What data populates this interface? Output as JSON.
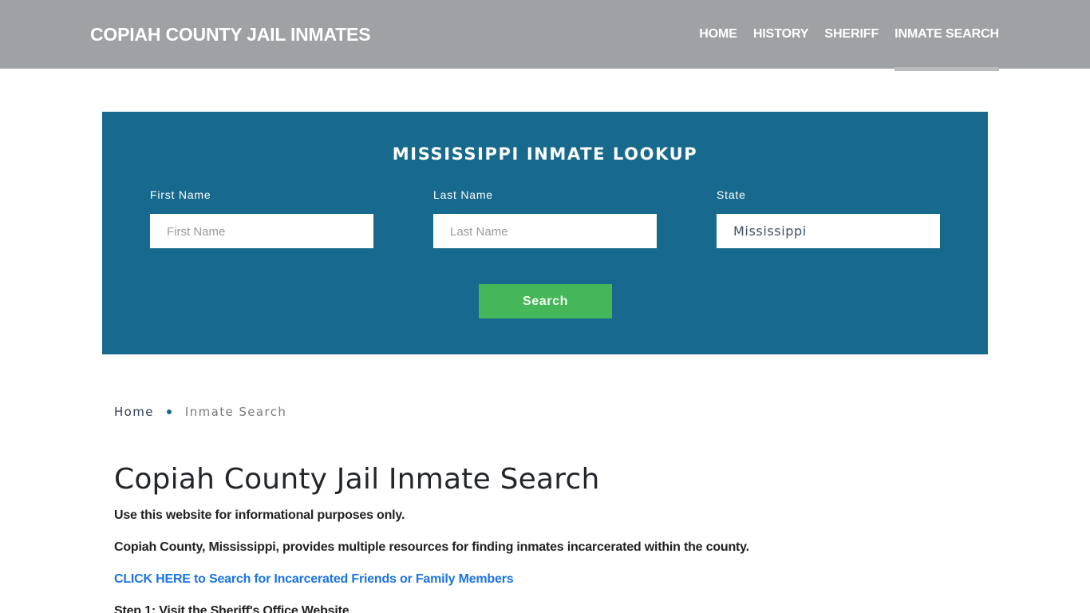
{
  "header": {
    "brand": "COPIAH COUNTY JAIL INMATES",
    "nav": [
      {
        "label": "HOME",
        "active": false
      },
      {
        "label": "HISTORY",
        "active": false
      },
      {
        "label": "SHERIFF",
        "active": false
      },
      {
        "label": "INMATE SEARCH",
        "active": true
      }
    ]
  },
  "lookup": {
    "title": "MISSISSIPPI INMATE LOOKUP",
    "fields": [
      {
        "label": "First Name",
        "placeholder": "First Name",
        "value": ""
      },
      {
        "label": "Last Name",
        "placeholder": "Last Name",
        "value": ""
      },
      {
        "label": "State",
        "placeholder": "",
        "value": "Mississippi"
      }
    ],
    "search_label": "Search",
    "colors": {
      "panel": "#176a8d",
      "button": "#45b758"
    }
  },
  "breadcrumb": {
    "home": "Home",
    "current": "Inmate Search"
  },
  "content": {
    "title": "Copiah County Jail Inmate Search",
    "paragraphs": [
      "Use this website for informational purposes only.",
      "Copiah County, Mississippi, provides multiple resources for finding inmates incarcerated within the county."
    ],
    "link": "CLICK HERE to Search for Incarcerated Friends or Family Members",
    "step1": "Step 1: Visit the Sheriff's Office Website"
  }
}
